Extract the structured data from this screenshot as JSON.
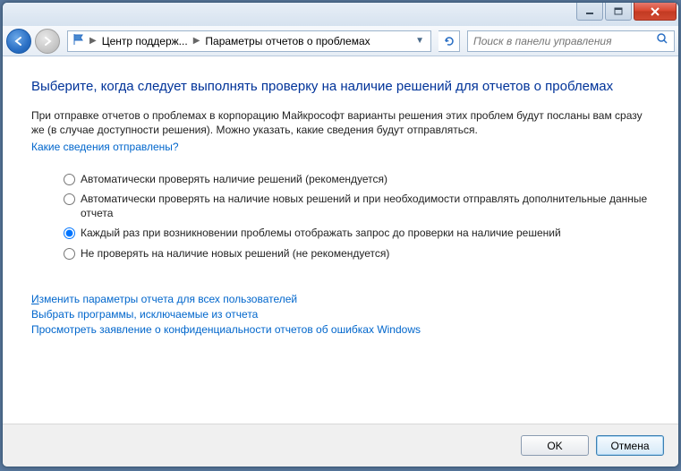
{
  "breadcrumb": {
    "item1": "Центр поддерж...",
    "item2": "Параметры отчетов о проблемах"
  },
  "search": {
    "placeholder": "Поиск в панели управления"
  },
  "heading": "Выберите, когда следует выполнять проверку на наличие решений для отчетов о проблемах",
  "intro": "При отправке отчетов о проблемах в корпорацию Майкрософт варианты решения этих проблем будут посланы вам сразу же (в случае доступности решения). Можно указать, какие сведения будут отправляться.",
  "intro_link": "Какие сведения отправлены?",
  "options": [
    "Автоматически проверять наличие решений (рекомендуется)",
    "Автоматически проверять на наличие новых решений и при необходимости отправлять дополнительные данные отчета",
    "Каждый раз при возникновении проблемы отображать запрос до проверки на наличие решений",
    "Не проверять на наличие новых решений (не рекомендуется)"
  ],
  "selected_option": 2,
  "bottom_links": {
    "l1_pre": "И",
    "l1_rest": "зменить параметры отчета для всех пользователей",
    "l2": "Выбрать программы, исключаемые из отчета",
    "l3": "Просмотреть заявление о конфиденциальности отчетов об ошибках Windows"
  },
  "buttons": {
    "ok": "OK",
    "cancel": "Отмена"
  }
}
